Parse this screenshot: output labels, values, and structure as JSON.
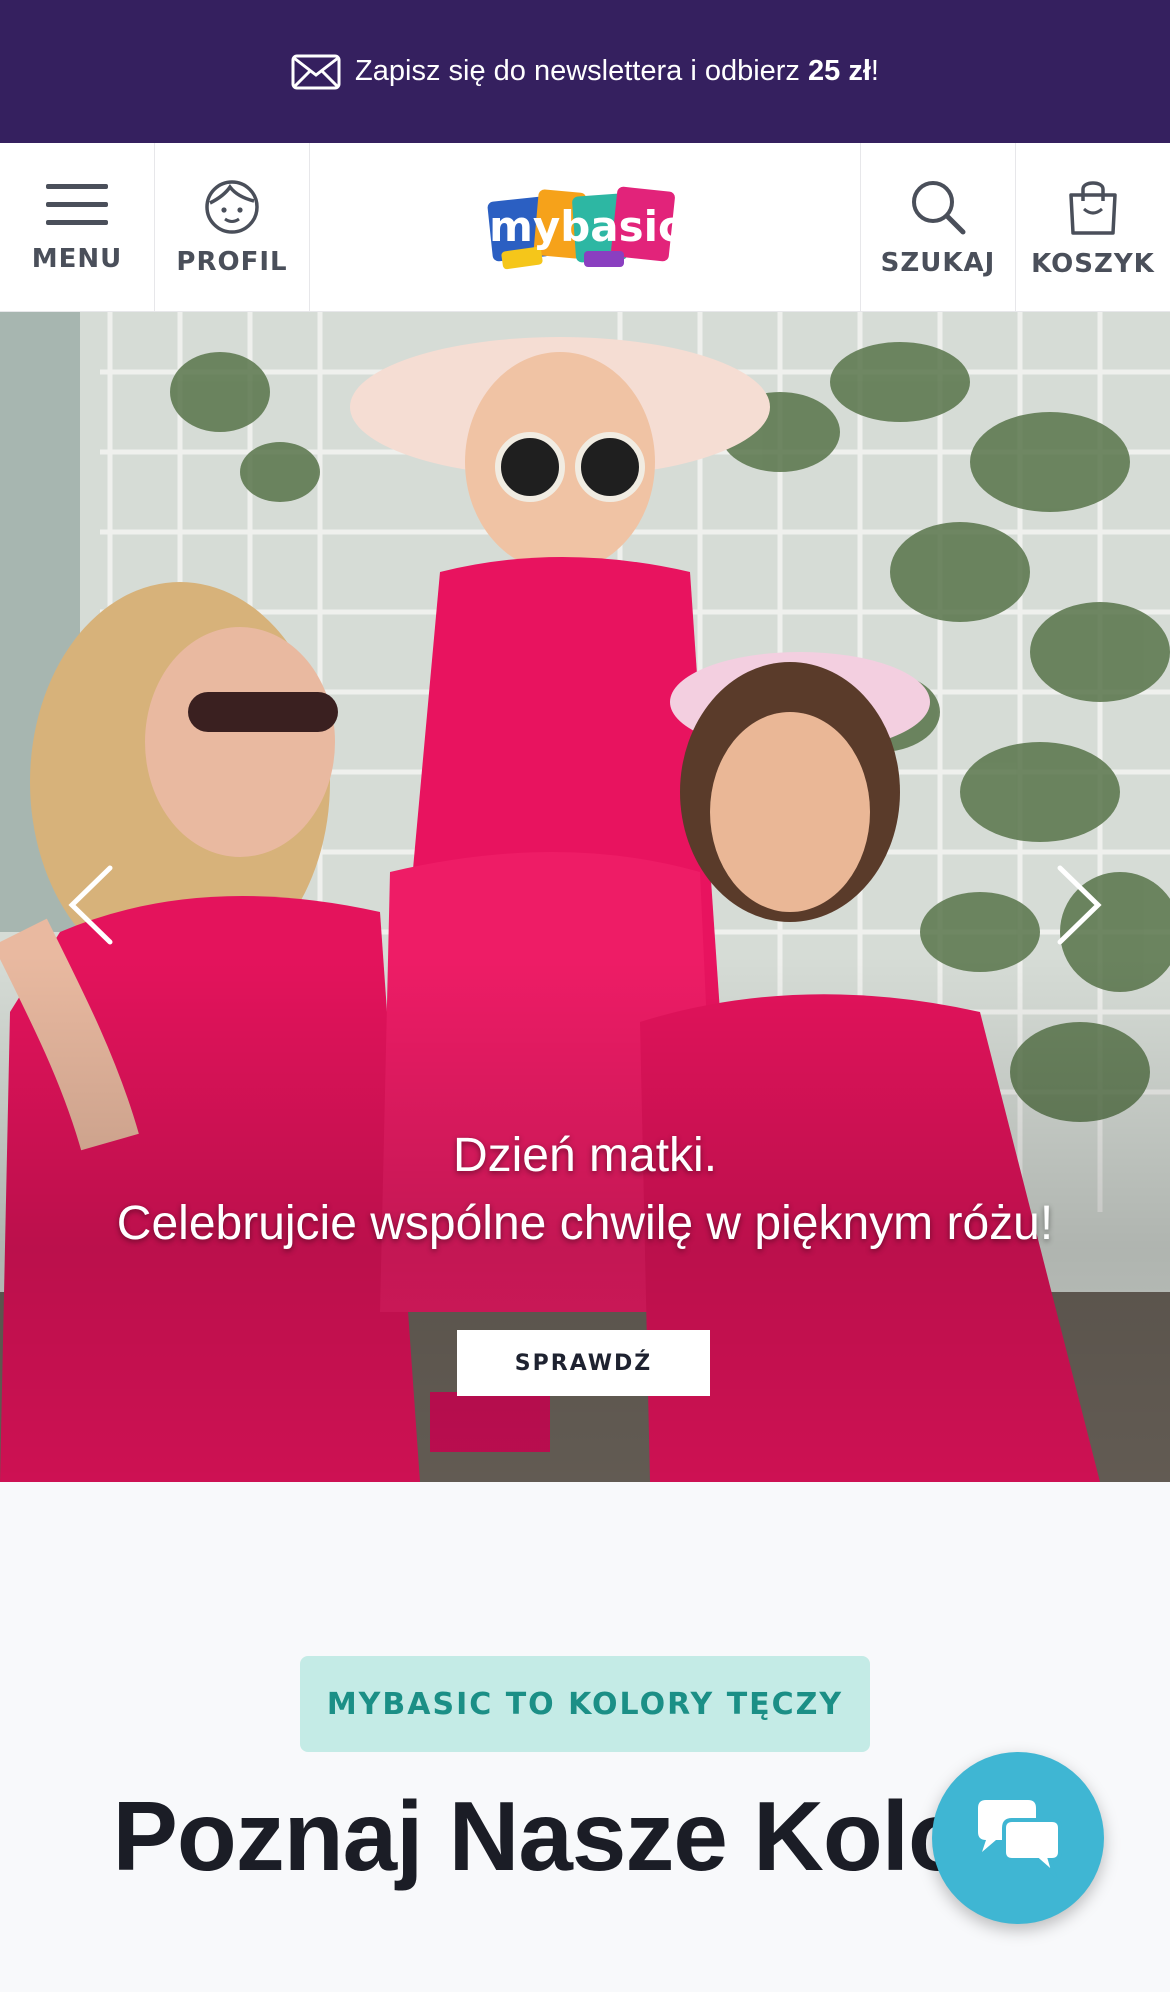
{
  "newsletter_bar": {
    "text_before": "Zapisz się do newslettera i odbierz ",
    "highlight": "25 zł",
    "text_after": "!",
    "icon": "mail-icon",
    "background": "#35205f"
  },
  "header": {
    "menu_label": "MENU",
    "profile_label": "PROFIL",
    "logo_text": "mybasic",
    "search_label": "SZUKAJ",
    "cart_label": "KOSZYK"
  },
  "hero": {
    "caption_line1": "Dzień matki.",
    "caption_line2": "Celebrujcie wspólne chwilę w pięknym różu!",
    "button_label": "SPRAWDŹ",
    "prev_icon": "chevron-left-icon",
    "next_icon": "chevron-right-icon",
    "accent": "#e8135f"
  },
  "colors_section": {
    "badge": "MYBASIC TO KOLORY TĘCZY",
    "title": "Poznaj Nasze Kolory"
  },
  "chat": {
    "icon": "chat-bubbles-icon",
    "color": "#3fb6d3"
  }
}
